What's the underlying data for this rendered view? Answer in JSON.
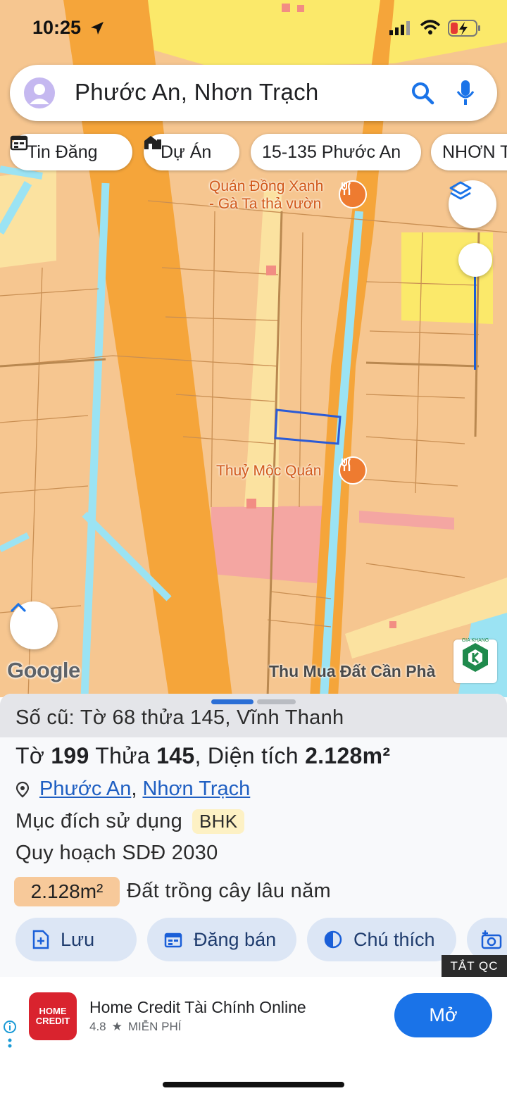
{
  "status": {
    "time": "10:25"
  },
  "search": {
    "text": "Phước An, Nhơn Trạch"
  },
  "chips": [
    {
      "label": "Tin Đăng",
      "icon": "calendar-icon"
    },
    {
      "label": "Dự Án",
      "icon": "building-icon"
    },
    {
      "label": "15-135 Phước An",
      "icon": ""
    },
    {
      "label": "NHƠN T",
      "icon": ""
    }
  ],
  "map": {
    "poi1": "Quán Đồng Xanh\n- Gà Ta thả vườn",
    "poi2": "Thuỷ Mộc Quán",
    "google": "Google",
    "watermark": "Thu Mua Đất Cần Phà",
    "watermark_brand": "GIA KHANG"
  },
  "sheet": {
    "old": "Số cũ: Tờ 68 thửa 145, Vĩnh Thanh",
    "lot_prefix": "Tờ ",
    "lot_sheet": "199",
    "lot_mid": " Thửa ",
    "lot_parcel": "145",
    "lot_suffix": ", Diện tích ",
    "lot_area": "2.128m²",
    "addr_commune": "Phước An",
    "addr_sep": ", ",
    "addr_district": "Nhơn Trạch",
    "purpose_label": "Mục đích sử dụng",
    "purpose_code": "BHK",
    "plan_label": "Quy hoạch SDĐ 2030",
    "plan_area": "2.128m²",
    "plan_desc": "Đất trồng cây lâu năm"
  },
  "actions": [
    {
      "label": "Lưu"
    },
    {
      "label": "Đăng bán"
    },
    {
      "label": "Chú thích"
    }
  ],
  "ad": {
    "close_label": "TẮT QC",
    "logo_top": "HOME",
    "logo_bottom": "CREDIT",
    "title": "Home Credit Tài Chính Online",
    "rating": "4.8",
    "price": "MIỄN PHÍ",
    "open_label": "Mở"
  },
  "colors": {
    "accent": "#1a73e8",
    "road": "#f5a53a",
    "plan_area": "#f7c99a",
    "parcel": "#2b5bd6"
  }
}
